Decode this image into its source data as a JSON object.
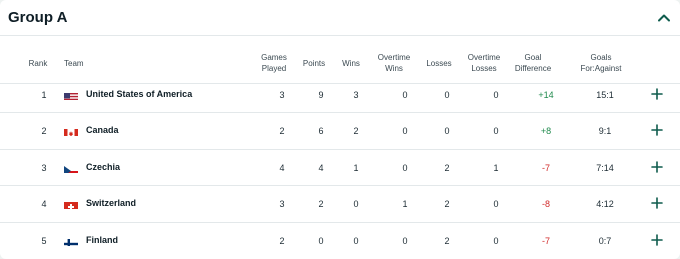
{
  "group": {
    "title": "Group A"
  },
  "columns": {
    "rank": "Rank",
    "team": "Team",
    "games_played": [
      "Games",
      "Played"
    ],
    "points": "Points",
    "wins": "Wins",
    "overtime_wins": [
      "Overtime",
      "Wins"
    ],
    "losses": "Losses",
    "overtime_losses": [
      "Overtime",
      "Losses"
    ],
    "goal_difference": [
      "Goal",
      "Difference"
    ],
    "goals_for_against": [
      "Goals",
      "For:Against"
    ]
  },
  "rows": [
    {
      "rank": "1",
      "team": "United States of America",
      "flag": "usa-flag-icon",
      "gp": "3",
      "pts": "9",
      "w": "3",
      "otw": "0",
      "l": "0",
      "otl": "0",
      "gd": "+14",
      "gfa": "15:1"
    },
    {
      "rank": "2",
      "team": "Canada",
      "flag": "canada-flag-icon",
      "gp": "2",
      "pts": "6",
      "w": "2",
      "otw": "0",
      "l": "0",
      "otl": "0",
      "gd": "+8",
      "gfa": "9:1"
    },
    {
      "rank": "3",
      "team": "Czechia",
      "flag": "czechia-flag-icon",
      "gp": "4",
      "pts": "4",
      "w": "1",
      "otw": "0",
      "l": "2",
      "otl": "1",
      "gd": "-7",
      "gfa": "7:14"
    },
    {
      "rank": "4",
      "team": "Switzerland",
      "flag": "switzerland-flag-icon",
      "gp": "3",
      "pts": "2",
      "w": "0",
      "otw": "1",
      "l": "2",
      "otl": "0",
      "gd": "-8",
      "gfa": "4:12"
    },
    {
      "rank": "5",
      "team": "Finland",
      "flag": "finland-flag-icon",
      "gp": "2",
      "pts": "0",
      "w": "0",
      "otw": "0",
      "l": "2",
      "otl": "0",
      "gd": "-7",
      "gfa": "0:7"
    }
  ],
  "colors": {
    "positive": "#1f8a4c",
    "negative": "#d12a2a",
    "accent": "#0f5c4d"
  }
}
